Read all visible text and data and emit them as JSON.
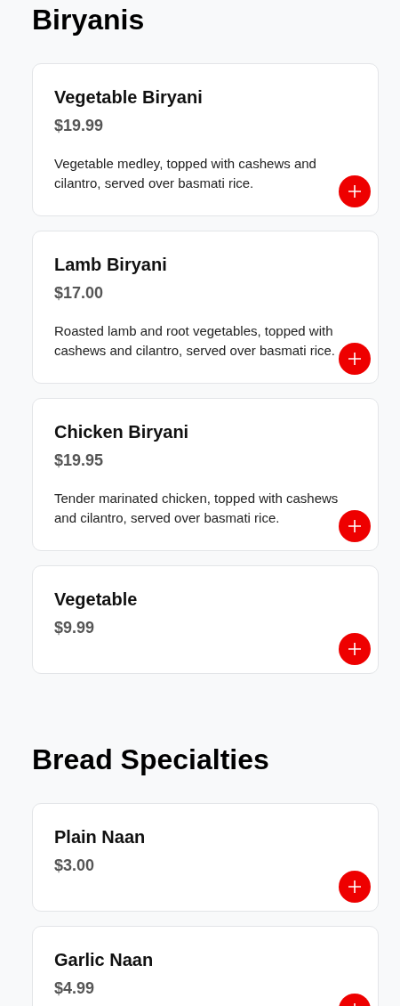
{
  "sections": [
    {
      "title": "Biryanis",
      "items": [
        {
          "name": "Vegetable Biryani",
          "price": "$19.99",
          "description": "Vegetable medley, topped with cashews and cilantro, served over basmati rice."
        },
        {
          "name": "Lamb Biryani",
          "price": "$17.00",
          "description": "Roasted lamb and root vegetables, topped with cashews and cilantro, served over basmati rice."
        },
        {
          "name": "Chicken Biryani",
          "price": "$19.95",
          "description": "Tender marinated chicken, topped with cashews and cilantro, served over basmati rice."
        },
        {
          "name": "Vegetable",
          "price": "$9.99"
        }
      ]
    },
    {
      "title": "Bread Specialties",
      "items": [
        {
          "name": "Plain Naan",
          "price": "$3.00"
        },
        {
          "name": "Garlic Naan",
          "price": "$4.99"
        }
      ]
    }
  ]
}
